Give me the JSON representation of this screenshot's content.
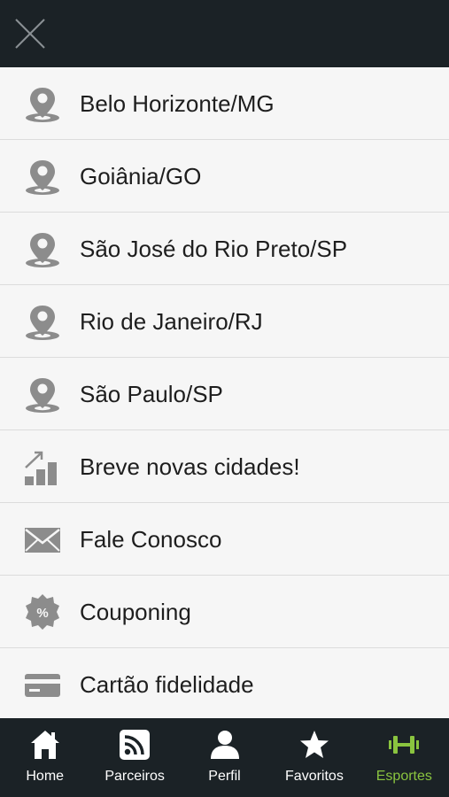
{
  "header": {
    "close_icon": "close-x-icon"
  },
  "colors": {
    "bar_background": "#1b2226",
    "menu_background": "#f6f6f6",
    "icon_gray": "#8c8c8c",
    "active_tab": "#8ac43f",
    "text": "#1e1e1e"
  },
  "menu": {
    "items": [
      {
        "label": "Belo Horizonte/MG",
        "icon": "map-pin-icon"
      },
      {
        "label": "Goiânia/GO",
        "icon": "map-pin-icon"
      },
      {
        "label": "São José do Rio Preto/SP",
        "icon": "map-pin-icon"
      },
      {
        "label": "Rio de Janeiro/RJ",
        "icon": "map-pin-icon"
      },
      {
        "label": "São Paulo/SP",
        "icon": "map-pin-icon"
      },
      {
        "label": "Breve novas cidades!",
        "icon": "growth-chart-icon"
      },
      {
        "label": "Fale Conosco",
        "icon": "envelope-icon"
      },
      {
        "label": "Couponing",
        "icon": "percent-badge-icon"
      },
      {
        "label": "Cartão fidelidade",
        "icon": "credit-card-icon"
      }
    ]
  },
  "tabbar": {
    "tabs": [
      {
        "label": "Home",
        "icon": "home-icon",
        "active": false
      },
      {
        "label": "Parceiros",
        "icon": "rss-icon",
        "active": false
      },
      {
        "label": "Perfil",
        "icon": "user-icon",
        "active": false
      },
      {
        "label": "Favoritos",
        "icon": "star-icon",
        "active": false
      },
      {
        "label": "Esportes",
        "icon": "dumbbell-icon",
        "active": true
      }
    ]
  }
}
